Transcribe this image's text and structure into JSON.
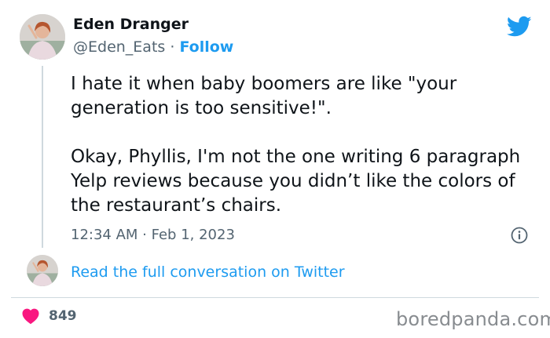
{
  "tweet": {
    "author_name": "Eden Dranger",
    "author_handle": "@Eden_Eats",
    "separator": "·",
    "follow_label": "Follow",
    "text_paragraph_1": "I hate it when baby boomers are like \"your generation is too sensitive!\".",
    "text_paragraph_2": "Okay, Phyllis, I'm not the one writing 6 paragraph Yelp reviews because you didn’t like the colors of the restaurant’s chairs.",
    "timestamp": "12:34 AM · Feb 1, 2023",
    "read_conversation_label": "Read the full conversation on Twitter",
    "like_count": "849"
  },
  "icons": {
    "brand": "twitter-bird-icon",
    "info": "info-icon",
    "like": "heart-icon"
  },
  "colors": {
    "accent": "#1d9bf0",
    "like": "#f91880",
    "text_primary": "#0f1419",
    "text_secondary": "#536471"
  },
  "watermark": {
    "text": "boredpanda.com"
  }
}
